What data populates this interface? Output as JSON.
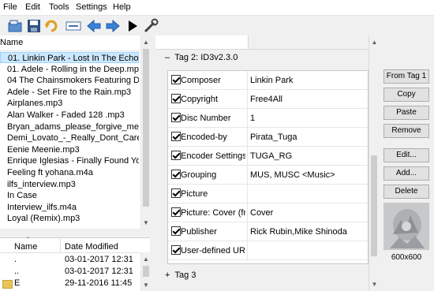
{
  "menu": [
    "File",
    "Edit",
    "Tools",
    "Settings",
    "Help"
  ],
  "toolbar": [
    {
      "icon": "open-icon"
    },
    {
      "icon": "save-icon"
    },
    {
      "icon": "undo-icon"
    },
    {
      "icon": "remove-tag-icon"
    },
    {
      "icon": "back-icon"
    },
    {
      "icon": "forward-icon"
    },
    {
      "icon": "play-icon"
    },
    {
      "icon": "tools-icon"
    }
  ],
  "file_list": {
    "column": "Name",
    "items": [
      "01. Linkin Park - Lost In The Echo.mp3",
      "01. Adele - Rolling in the Deep.mp3",
      "04  The Chainsmokers Featuring Daya - ",
      "Adele - Set Fire to the Rain.mp3",
      "Airplanes.mp3",
      "Alan Walker - Faded  128 .mp3",
      "Bryan_adams_please_forgive_me_aac_20",
      "Demi_Lovato_-_Really_Dont_Care_feat_C",
      "Eenie Meenie.mp3",
      "Enrique Iglesias - Finally Found You [DJx",
      "Feeling ft yohana.m4a",
      "ilfs_interview.mp3",
      "In Case",
      "Interview_ilfs.m4a",
      "Loyal (Remix).mp3"
    ],
    "selected_index": 0
  },
  "browser": {
    "headers": [
      "Name",
      "Date Modified"
    ],
    "rows": [
      {
        "name": ".",
        "date": "03-01-2017 12:31"
      },
      {
        "name": "..",
        "date": "03-01-2017 12:31"
      },
      {
        "name": "E",
        "date": "29-11-2016 11:45"
      }
    ]
  },
  "tag2": {
    "title": "Tag 2: ID3v2.3.0",
    "rows": [
      {
        "field": "Composer",
        "value": "Linkin Park"
      },
      {
        "field": "Copyright",
        "value": "Free4All"
      },
      {
        "field": "Disc Number",
        "value": "1"
      },
      {
        "field": "Encoded-by",
        "value": "Pirata_Tuga"
      },
      {
        "field": "Encoder Settings",
        "value": "TUGA_RG"
      },
      {
        "field": "Grouping",
        "value": "MUS, MUSC <Music>"
      },
      {
        "field": "Picture",
        "value": ""
      },
      {
        "field": "Picture: Cover (fr...",
        "value": "Cover"
      },
      {
        "field": "Publisher",
        "value": "Rick Rubin,Mike Shinoda"
      },
      {
        "field": "User-defined URL",
        "value": ""
      }
    ]
  },
  "tag3": {
    "title": "Tag 3"
  },
  "buttons": [
    "From Tag 1",
    "Copy",
    "Paste",
    "Remove",
    "Edit...",
    "Add...",
    "Delete"
  ],
  "cover": {
    "size": "600x600"
  }
}
